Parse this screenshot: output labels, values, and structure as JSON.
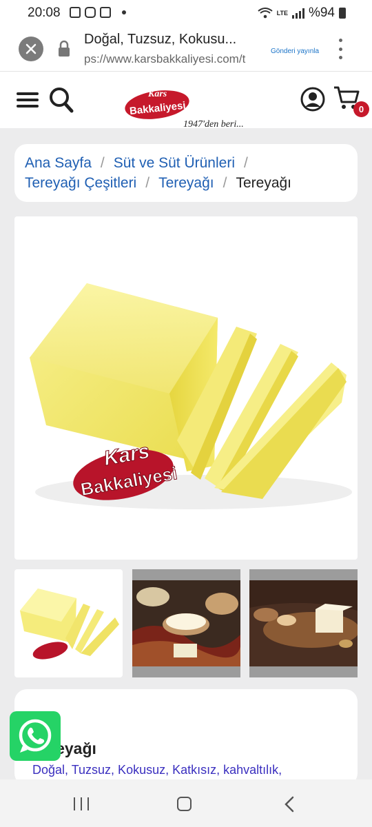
{
  "status_bar": {
    "time": "20:08",
    "battery": "%94",
    "network": "LTE"
  },
  "browser": {
    "page_title": "Doğal, Tuzsuz, Kokusu...",
    "url": "ps://www.karsbakkaliyesi.com/t",
    "share_label": "Gönderi yayınla"
  },
  "header": {
    "logo_text_line1": "Kars",
    "logo_text_line2": "Bakkaliyesi",
    "logo_tagline": "1947'den beri...",
    "cart_count": "0"
  },
  "breadcrumb": {
    "items": [
      "Ana Sayfa",
      "Süt ve Süt Ürünleri",
      "Tereyağı Çeşitleri",
      "Tereyağı"
    ],
    "current": "Tereyağı"
  },
  "main_image": {
    "watermark_line1": "Kars",
    "watermark_line2": "Bakkaliyesi"
  },
  "product": {
    "name": "Tereyağı",
    "description": "Doğal, Tuzsuz, Kokusuz, Katkısız, kahvaltılık,"
  },
  "colors": {
    "brand_red": "#c6192b",
    "link_blue": "#1f5fb3",
    "whatsapp_green": "#25d366",
    "butter_yellow": "#f3e86a"
  }
}
